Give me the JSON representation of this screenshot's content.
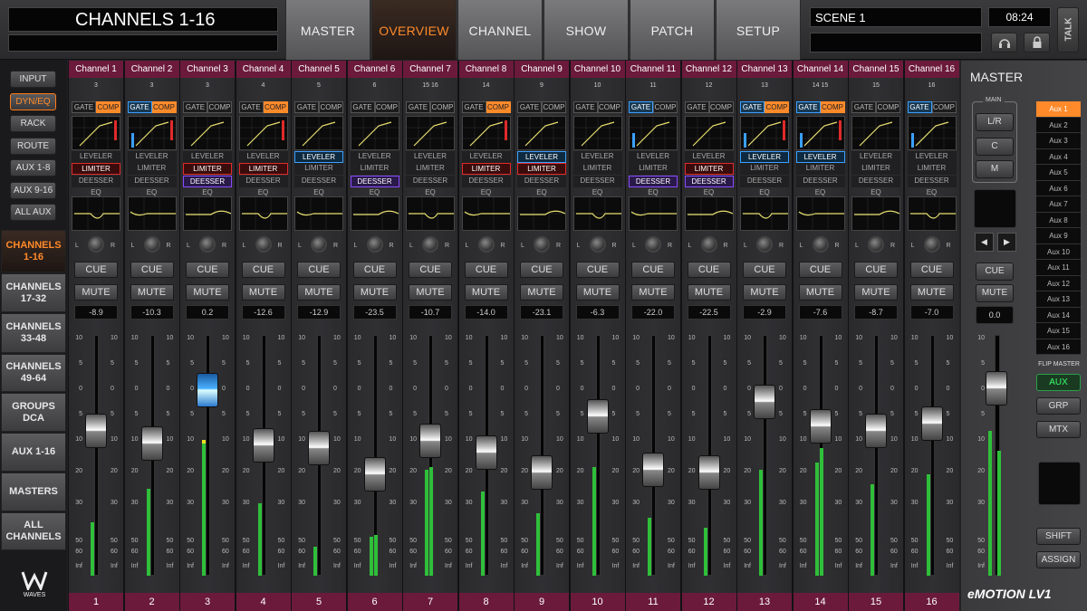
{
  "header": {
    "title": "CHANNELS 1-16",
    "scene": "SCENE 1",
    "clock": "08:24",
    "talk": "TALK"
  },
  "nav": [
    "MASTER",
    "OVERVIEW",
    "CHANNEL",
    "SHOW",
    "PATCH",
    "SETUP"
  ],
  "nav_active": 1,
  "left_small": [
    "INPUT",
    "DYN/EQ",
    "RACK",
    "ROUTE",
    "AUX 1-8",
    "AUX 9-16",
    "ALL AUX"
  ],
  "left_small_active": 1,
  "left_big": [
    "CHANNELS\n1-16",
    "CHANNELS\n17-32",
    "CHANNELS\n33-48",
    "CHANNELS\n49-64",
    "GROUPS\nDCA",
    "AUX 1-16",
    "MASTERS",
    "ALL\nCHANNELS"
  ],
  "left_big_active": 0,
  "waves_label": "WAVES",
  "labels": {
    "gate": "GATE",
    "comp": "COMP",
    "leveler": "LEVELER",
    "limiter": "LIMITER",
    "deesser": "DEESSER",
    "eq": "EQ",
    "cue": "CUE",
    "mute": "MUTE",
    "pan_l": "L",
    "pan_r": "R"
  },
  "scale": [
    "10",
    "5",
    "0",
    "5",
    "10",
    "20",
    "30",
    "50",
    "60",
    "Inf"
  ],
  "channels": [
    {
      "name": "Channel 1",
      "src": "3",
      "num": "1",
      "gain": "-8.9",
      "gate": 0,
      "comp": 1,
      "lev": 0,
      "lim": 1,
      "dee": 0,
      "fader": 0.4,
      "meter": [
        0.22,
        0
      ],
      "sel": 0
    },
    {
      "name": "Channel 2",
      "src": "3",
      "num": "2",
      "gain": "-10.3",
      "gate": 1,
      "comp": 1,
      "lev": 0,
      "lim": 0,
      "dee": 0,
      "fader": 0.45,
      "meter": [
        0.36,
        0
      ],
      "sel": 0
    },
    {
      "name": "Channel 3",
      "src": "3",
      "num": "3",
      "gain": "0.2",
      "gate": 0,
      "comp": 0,
      "lev": 0,
      "lim": 1,
      "dee": 1,
      "fader": 0.23,
      "meter": [
        0.55,
        0
      ],
      "sel": 1
    },
    {
      "name": "Channel 4",
      "src": "4",
      "num": "4",
      "gain": "-12.6",
      "gate": 0,
      "comp": 1,
      "lev": 0,
      "lim": 1,
      "dee": 0,
      "fader": 0.46,
      "meter": [
        0.3,
        0
      ],
      "sel": 0
    },
    {
      "name": "Channel 5",
      "src": "5",
      "num": "5",
      "gain": "-12.9",
      "gate": 0,
      "comp": 0,
      "lev": 1,
      "lim": 0,
      "dee": 0,
      "fader": 0.47,
      "meter": [
        0.12,
        0
      ],
      "sel": 0
    },
    {
      "name": "Channel 6",
      "src": "6",
      "num": "6",
      "gain": "-23.5",
      "gate": 0,
      "comp": 0,
      "lev": 0,
      "lim": 0,
      "dee": 1,
      "fader": 0.58,
      "meter": [
        0.16,
        0.17
      ],
      "sel": 0
    },
    {
      "name": "Channel 7",
      "src": "15  16",
      "num": "7",
      "gain": "-10.7",
      "gate": 0,
      "comp": 0,
      "lev": 0,
      "lim": 0,
      "dee": 0,
      "fader": 0.44,
      "meter": [
        0.44,
        0.45
      ],
      "sel": 0
    },
    {
      "name": "Channel 8",
      "src": "14",
      "num": "8",
      "gain": "-14.0",
      "gate": 0,
      "comp": 1,
      "lev": 0,
      "lim": 1,
      "dee": 0,
      "fader": 0.49,
      "meter": [
        0.35,
        0
      ],
      "sel": 0
    },
    {
      "name": "Channel 9",
      "src": "9",
      "num": "9",
      "gain": "-23.1",
      "gate": 0,
      "comp": 0,
      "lev": 1,
      "lim": 1,
      "dee": 0,
      "fader": 0.57,
      "meter": [
        0.26,
        0
      ],
      "sel": 0
    },
    {
      "name": "Channel 10",
      "src": "10",
      "num": "10",
      "gain": "-6.3",
      "gate": 0,
      "comp": 0,
      "lev": 0,
      "lim": 0,
      "dee": 0,
      "fader": 0.34,
      "meter": [
        0.45,
        0
      ],
      "sel": 0
    },
    {
      "name": "Channel 11",
      "src": "11",
      "num": "11",
      "gain": "-22.0",
      "gate": 1,
      "comp": 0,
      "lev": 0,
      "lim": 0,
      "dee": 1,
      "fader": 0.56,
      "meter": [
        0.24,
        0
      ],
      "sel": 0
    },
    {
      "name": "Channel 12",
      "src": "12",
      "num": "12",
      "gain": "-22.5",
      "gate": 0,
      "comp": 0,
      "lev": 0,
      "lim": 1,
      "dee": 1,
      "fader": 0.57,
      "meter": [
        0.2,
        0
      ],
      "sel": 0
    },
    {
      "name": "Channel 13",
      "src": "13",
      "num": "13",
      "gain": "-2.9",
      "gate": 1,
      "comp": 1,
      "lev": 1,
      "lim": 0,
      "dee": 0,
      "fader": 0.28,
      "meter": [
        0.44,
        0
      ],
      "sel": 0
    },
    {
      "name": "Channel 14",
      "src": "14  15",
      "num": "14",
      "gain": "-7.6",
      "gate": 1,
      "comp": 1,
      "lev": 1,
      "lim": 0,
      "dee": 0,
      "fader": 0.38,
      "meter": [
        0.47,
        0.53
      ],
      "sel": 0
    },
    {
      "name": "Channel 15",
      "src": "15",
      "num": "15",
      "gain": "-8.7",
      "gate": 0,
      "comp": 0,
      "lev": 0,
      "lim": 0,
      "dee": 0,
      "fader": 0.4,
      "meter": [
        0.38,
        0
      ],
      "sel": 0
    },
    {
      "name": "Channel 16",
      "src": "16",
      "num": "16",
      "gain": "-7.0",
      "gate": 1,
      "comp": 0,
      "lev": 0,
      "lim": 0,
      "dee": 0,
      "fader": 0.37,
      "meter": [
        0.42,
        0
      ],
      "sel": 0
    }
  ],
  "master": {
    "title": "MASTER",
    "main_label": "MAIN",
    "main_buttons": [
      "L/R",
      "C",
      "M"
    ],
    "cue": "CUE",
    "mute": "MUTE",
    "gain": "0.0",
    "aux": [
      "Aux 1",
      "Aux 2",
      "Aux 3",
      "Aux 4",
      "Aux 5",
      "Aux 6",
      "Aux 7",
      "Aux 8",
      "Aux 9",
      "Aux 10",
      "Aux 11",
      "Aux 12",
      "Aux 13",
      "Aux 14",
      "Aux 15",
      "Aux 16"
    ],
    "aux_selected": 0,
    "flip_label": "FLIP MASTER",
    "flip_buttons": [
      "AUX",
      "GRP",
      "MTX"
    ],
    "flip_active": 0,
    "shift": "SHIFT",
    "assign": "ASSIGN",
    "fader": 0.22,
    "meter": [
      0.6,
      0.52
    ],
    "scale": [
      "10",
      "5",
      "0",
      "5",
      "10",
      "20",
      "30",
      "50",
      "60",
      "Inf"
    ]
  },
  "brand": "eMOTION LV1",
  "colors": {
    "accent": "#ff8a2a",
    "channel_bar": "#6b1a3c",
    "meter": "#2fbf3a",
    "gate": "#3aa0ff",
    "limiter": "#e02a2a",
    "deesser": "#8a4aff"
  }
}
